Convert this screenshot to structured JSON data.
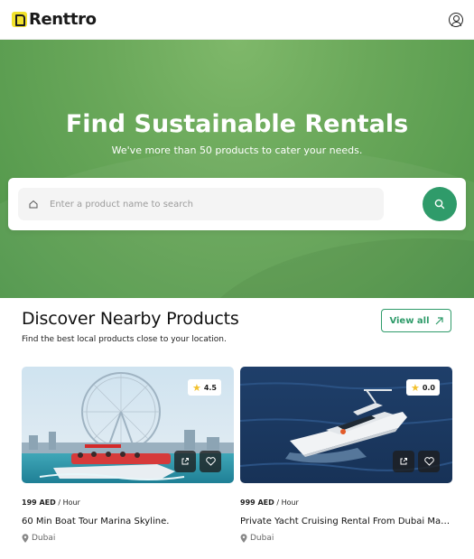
{
  "header": {
    "brand": "Renttro",
    "icons": {
      "logo": "renttro-logo",
      "account": "user-circle-icon"
    }
  },
  "hero": {
    "title": "Find Sustainable Rentals",
    "subtitle": "We've more than 50 products to cater your needs.",
    "search": {
      "placeholder": "Enter a product name to search",
      "value": "",
      "button_icon": "search-icon"
    }
  },
  "section": {
    "title": "Discover Nearby Products",
    "subtitle": "Find the best local products close to your location.",
    "view_all": "View all"
  },
  "products": [
    {
      "rating": "4.5",
      "price": "199 AED",
      "unit": "/ Hour",
      "title": "60 Min Boat Tour Marina Skyline.",
      "location": "Dubai"
    },
    {
      "rating": "0.0",
      "price": "999 AED",
      "unit": "/ Hour",
      "title": "Private Yacht Cruising Rental From Dubai Marina",
      "location": "Dubai"
    }
  ],
  "colors": {
    "accent": "#2f9b6a",
    "hero": "#6aa85a",
    "logo": "#f2e22c",
    "star": "#f2c12e"
  }
}
